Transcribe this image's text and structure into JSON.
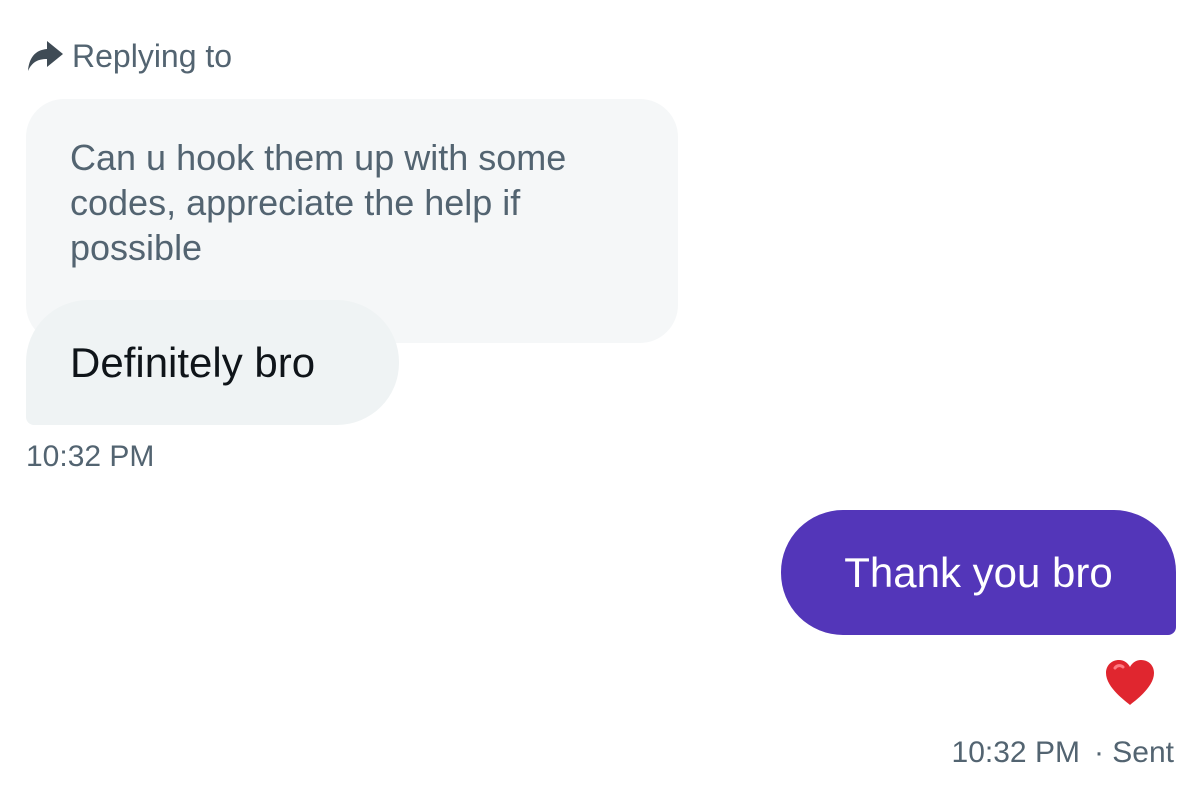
{
  "reply_header": {
    "label": "Replying to",
    "icon": "reply-arrow-icon"
  },
  "quoted_message": {
    "text": "Can u hook them up with some codes, appreciate the help if possible"
  },
  "incoming_message": {
    "text": "Definitely bro",
    "timestamp": "10:32 PM"
  },
  "outgoing_message": {
    "text": "Thank you bro",
    "reaction_icon": "red-heart-icon",
    "timestamp": "10:32 PM",
    "status": "· Sent"
  },
  "colors": {
    "outgoing_bubble": "#5336b9",
    "incoming_bubble": "#eff3f4",
    "quoted_bubble": "#f5f7f8",
    "secondary_text": "#536471",
    "heart": "#e0262f"
  }
}
